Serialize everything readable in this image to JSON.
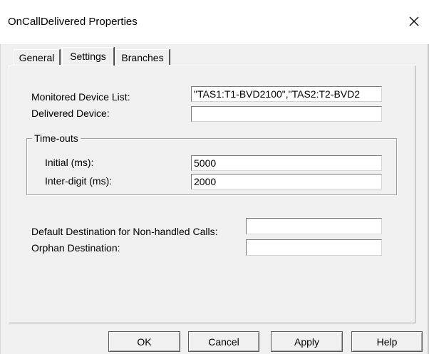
{
  "window": {
    "title": "OnCallDelivered Properties"
  },
  "tabs": [
    {
      "label": "General",
      "active": false
    },
    {
      "label": "Settings",
      "active": true
    },
    {
      "label": "Branches",
      "active": false
    }
  ],
  "settings": {
    "monitored_device_list": {
      "label": "Monitored Device List:",
      "value": "\"TAS1:T1-BVD2100\",\"TAS2:T2-BVD2"
    },
    "delivered_device": {
      "label": "Delivered Device:",
      "value": ""
    },
    "timeouts": {
      "group_label": "Time-outs",
      "initial": {
        "label": "Initial (ms):",
        "value": "5000"
      },
      "inter_digit": {
        "label": "Inter-digit (ms):",
        "value": "2000"
      }
    },
    "default_destination": {
      "label": "Default Destination for Non-handled Calls:",
      "value": ""
    },
    "orphan_destination": {
      "label": "Orphan Destination:",
      "value": ""
    }
  },
  "buttons": {
    "ok": "OK",
    "cancel": "Cancel",
    "apply": "Apply",
    "help": "Help"
  },
  "icons": {
    "close": "close-icon"
  }
}
